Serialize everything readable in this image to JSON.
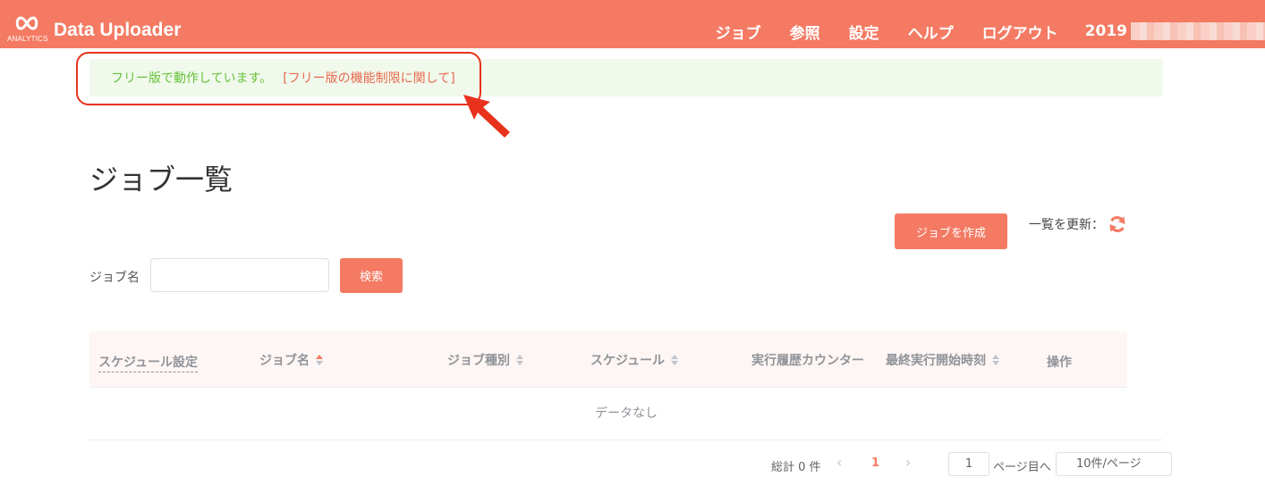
{
  "header": {
    "logo_text": "ANALYTICS",
    "app_title": "Data Uploader",
    "nav": [
      "ジョブ",
      "参照",
      "設定",
      "ヘルプ",
      "ログアウト"
    ],
    "user": "2019"
  },
  "notice": {
    "text": "フリー版で動作しています。",
    "link": "[フリー版の機能制限に関して]"
  },
  "page": {
    "title": "ジョブ一覧",
    "create_button": "ジョブを作成",
    "refresh_label": "一覧を更新："
  },
  "search": {
    "label": "ジョブ名",
    "value": "",
    "button": "検索"
  },
  "table": {
    "columns": [
      "スケジュール設定",
      "ジョブ名",
      "ジョブ種別",
      "スケジュール",
      "実行履歴カウンター",
      "最終実行開始時刻",
      "操作"
    ],
    "empty_text": "データなし"
  },
  "pagination": {
    "total": "総計 0 件",
    "current_page": "1",
    "jump_value": "1",
    "jump_label": "ページ目へ",
    "page_size": "10件/ページ"
  },
  "colors": {
    "brand": "#f47a63",
    "notice_bg": "#f0f9eb",
    "notice_text": "#67c23a",
    "annotation": "#e8321c"
  }
}
